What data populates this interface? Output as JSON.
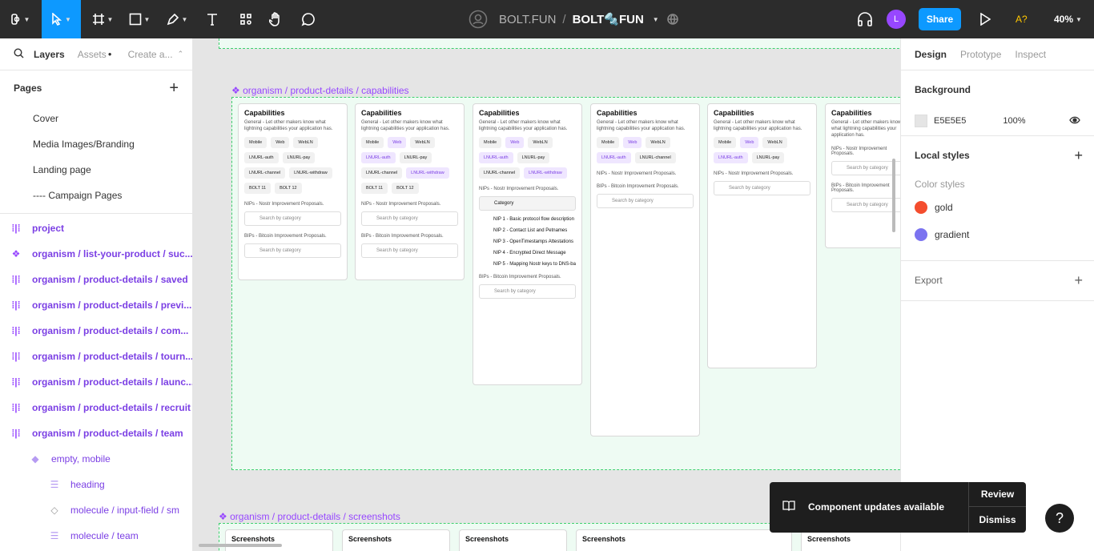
{
  "toolbar": {
    "project": "BOLT.FUN",
    "separator": "/",
    "file": "BOLT🔩FUN",
    "share": "Share",
    "avatar": "L",
    "a11y": "A?",
    "zoom": "40%"
  },
  "left": {
    "tabs": [
      "Layers",
      "Assets",
      "Create a..."
    ],
    "pages_title": "Pages",
    "pages": [
      "Cover",
      "Media Images/Branding",
      "Landing page",
      "---- Campaign Pages"
    ],
    "layers": [
      "project",
      "organism / list-your-product / suc...",
      "organism / product-details / saved",
      "organism / product-details /  previ...",
      "organism / product-details / com...",
      "organism / product-details / tourn...",
      "organism / product-details / launc...",
      "organism / product-details / recruit",
      "organism / product-details / team"
    ],
    "sub_layers": [
      "empty, mobile",
      "heading",
      "molecule / input-field / sm",
      "molecule / team"
    ]
  },
  "right": {
    "tabs": [
      "Design",
      "Prototype",
      "Inspect"
    ],
    "background_title": "Background",
    "bg_hex": "E5E5E5",
    "bg_opacity": "100%",
    "local_styles": "Local styles",
    "color_styles": "Color styles",
    "styles": [
      {
        "name": "gold",
        "color": "#f44d2e"
      },
      {
        "name": "gradient",
        "color": "#7b73f0"
      }
    ],
    "export": "Export"
  },
  "canvas": {
    "frame1": "organism / product-details / capabilities",
    "frame2": "organism / product-details / screenshots",
    "card_title": "Capabilities",
    "card_desc": "General - Let other makers know what lightning capabilities your application has.",
    "nips": "NIPs - Nostr Improvement Proposals.",
    "bips": "BIPs - Bitcoin Improvement Proposals.",
    "search": "Search by category",
    "chips": [
      "Mobile",
      "Web",
      "WebLN",
      "LNURL-auth",
      "LNURL-pay",
      "LNURL-channel",
      "LNURL-withdraw",
      "BOLT 11",
      "BOLT 12"
    ],
    "results": [
      "NIP 1 - Basic protocol flow description",
      "NIP 2 - Contact List and Petnames",
      "NIP 3 - OpenTimestamps Attestations",
      "NIP 4 - Encrypted Direct Message",
      "NIP 5 - Mapping Nostr keys to DNS-ba"
    ],
    "screenshots_title": "Screenshots"
  },
  "toast": {
    "message": "Component updates available",
    "review": "Review",
    "dismiss": "Dismiss"
  }
}
